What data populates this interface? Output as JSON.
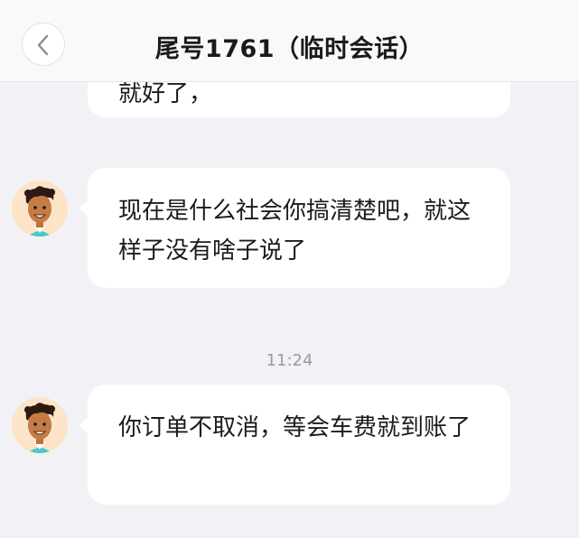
{
  "header": {
    "title": "尾号1761（临时会话）",
    "back_icon": "chevron-left-icon"
  },
  "messages": [
    {
      "text": "就好了，",
      "partial": true
    },
    {
      "text": "现在是什么社会你搞清楚吧，就这样子没有啥子说了",
      "avatar": "driver-avatar"
    },
    {
      "timestamp": "11:24"
    },
    {
      "text": "你订单不取消，等会车费就到账了",
      "avatar": "driver-avatar"
    }
  ],
  "colors": {
    "background": "#f2f2f6",
    "bubble": "#ffffff",
    "avatar_bg": "#fde3c7"
  }
}
